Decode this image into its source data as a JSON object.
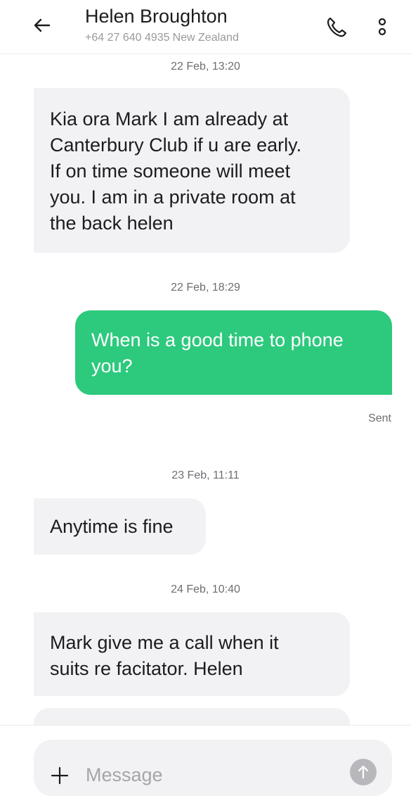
{
  "header": {
    "contact_name": "Helen Broughton",
    "phone": "+64 27 640 4935",
    "country": "New Zealand",
    "back_icon": "arrow-left-icon",
    "call_icon": "phone-icon",
    "more_icon": "more-vertical-icon"
  },
  "messages": [
    {
      "timestamp": "22 Feb, 13:20",
      "direction": "incoming",
      "lines": [
        "Kia ora Mark I am already at",
        "Canterbury Club if u are early.",
        "If on time someone will meet",
        "you. I am in a private room at",
        "the back helen"
      ]
    },
    {
      "timestamp": "22 Feb, 18:29",
      "direction": "outgoing",
      "lines": [
        "When is a good time to phone",
        "you?"
      ],
      "status": "Sent"
    },
    {
      "timestamp": "23 Feb, 11:11",
      "direction": "incoming",
      "lines": [
        "Anytime is fine"
      ]
    },
    {
      "timestamp": "24 Feb, 10:40",
      "direction": "incoming",
      "lines": [
        "Mark give me a call when it",
        "suits re facitator. Helen"
      ]
    }
  ],
  "composer": {
    "placeholder": "Message",
    "add_icon": "plus-icon",
    "send_icon": "send-arrow-up-icon"
  },
  "colors": {
    "outgoing_bubble": "#2dc97d",
    "incoming_bubble": "#f2f2f4",
    "muted_text": "#6e6e73"
  }
}
